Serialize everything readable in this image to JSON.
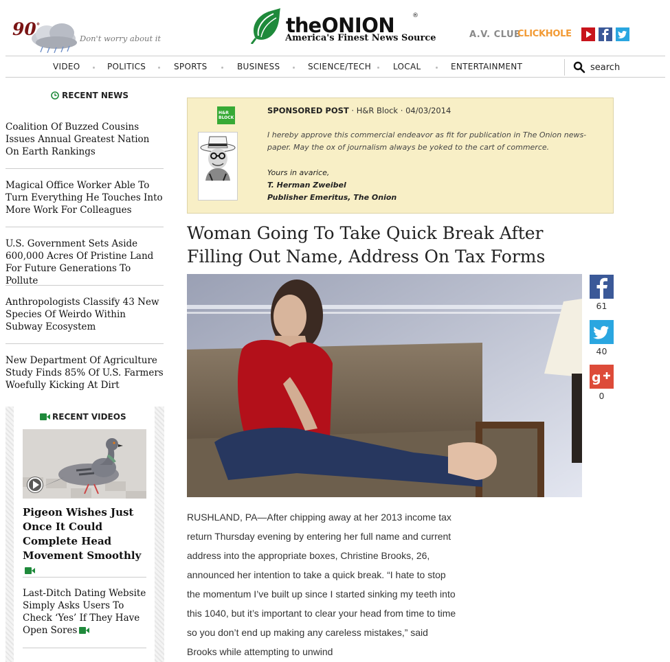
{
  "header": {
    "weather": {
      "temperature": "90",
      "degree": "°",
      "tagline": "Don't worry about it"
    },
    "logo": {
      "the": "the",
      "onion": "ONION",
      "reg": "®",
      "subtitle": "America's Finest News Source"
    },
    "partners": {
      "avclub": "A.V. CLUB",
      "clickhole": "CLICKHOLE"
    },
    "icons": [
      "youtube-icon",
      "facebook-icon",
      "twitter-icon"
    ]
  },
  "nav": {
    "items": [
      "VIDEO",
      "POLITICS",
      "SPORTS",
      "BUSINESS",
      "SCIENCE/TECH",
      "LOCAL",
      "ENTERTAINMENT"
    ],
    "search_label": "search"
  },
  "sidebar": {
    "recent_news_heading": "RECENT NEWS",
    "news": [
      "Coalition Of Buzzed Cousins Issues Annual Greatest Nation On Earth Rankings",
      "Magical Office Worker Able To Turn Everything He Touches Into More Work For Colleagues",
      "U.S. Government Sets Aside 600,000 Acres Of Pristine Land For Future Generations To Pollute",
      "Anthropologists Classify 43 New Species Of Weirdo Within Subway Ecosystem",
      "New Department Of Agriculture Study Finds 85% Of U.S. Farmers Woefully Kicking At Dirt"
    ],
    "recent_videos_heading": "RECENT VIDEOS",
    "videos": [
      "Pigeon Wishes Just Once It Could Complete Head Movement Smoothly",
      "Last-Ditch Dating Website Simply Asks Users To Check ‘Yes’ If They Have Open Sores"
    ]
  },
  "sponsored": {
    "logo_text": "H&R BLOCK",
    "label": "SPONSORED POST",
    "meta": " · H&R Block · 04/03/2014",
    "text": "I hereby approve this commercial endeavor as fit for publication in The Onion news-paper. May the ox of journalism always be yoked to the cart of commerce.",
    "closing": "Yours in avarice,",
    "signer": "T. Herman Zweibel",
    "signer_title": "Publisher Emeritus, The Onion"
  },
  "article": {
    "headline": "Woman Going To Take Quick Break After Filling Out Name, Address On Tax Forms",
    "body": "RUSHLAND, PA—After chipping away at her 2013 income tax return Thursday evening by entering her full name and current address into the appropriate boxes, Christine Brooks, 26, announced her intention to take a quick break. “I hate to stop the momentum I’ve built up since I started sinking my teeth into this 1040, but it’s important to clear your head from time to time so you don’t end up making any careless mistakes,” said Brooks while attempting to unwind"
  },
  "share": {
    "facebook_count": "61",
    "twitter_count": "40",
    "googleplus_count": "0"
  },
  "colors": {
    "onion_green": "#1f8a3b",
    "temperature_red": "#7a1414",
    "sponsor_bg": "#f8efc6",
    "facebook": "#3b5998",
    "twitter": "#2aa6e0",
    "googleplus": "#dd4b39"
  }
}
